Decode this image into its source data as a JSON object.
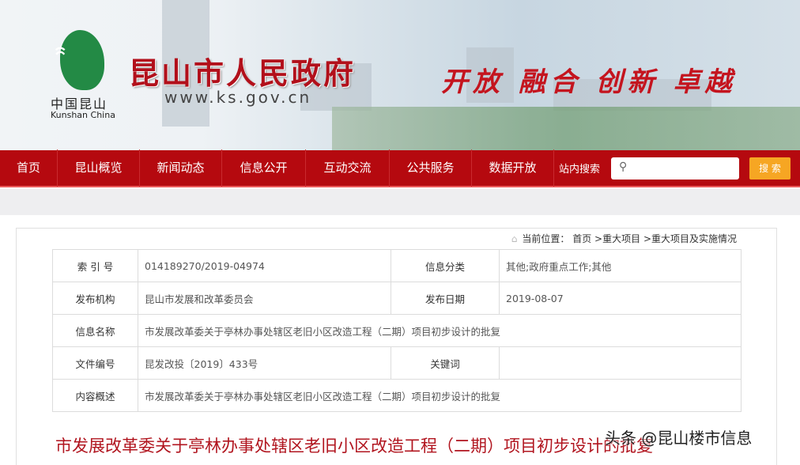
{
  "header": {
    "logo_cn": "中国昆山",
    "logo_en": "Kunshan China",
    "title": "昆山市人民政府",
    "url": "www.ks.gov.cn",
    "slogan": "开放 融合 创新 卓越"
  },
  "nav": {
    "items": [
      "首页",
      "昆山概览",
      "新闻动态",
      "信息公开",
      "互动交流",
      "公共服务",
      "数据开放"
    ],
    "search_label": "站内搜索",
    "search_placeholder": "",
    "search_button": "搜 索"
  },
  "breadcrumb": {
    "prefix": "当前位置：",
    "items": [
      "首页",
      ">重大项目",
      ">重大项目及实施情况"
    ]
  },
  "info": {
    "index_label": "索 引 号",
    "index_value": "014189270/2019-04974",
    "category_label": "信息分类",
    "category_value": "其他;政府重点工作;其他",
    "org_label": "发布机构",
    "org_value": "昆山市发展和改革委员会",
    "date_label": "发布日期",
    "date_value": "2019-08-07",
    "name_label": "信息名称",
    "name_value": "市发展改革委关于亭林办事处辖区老旧小区改造工程（二期）项目初步设计的批复",
    "docno_label": "文件编号",
    "docno_value": "昆发改投〔2019〕433号",
    "keyword_label": "关键词",
    "keyword_value": "",
    "summary_label": "内容概述",
    "summary_value": "市发展改革委关于亭林办事处辖区老旧小区改造工程（二期）项目初步设计的批复"
  },
  "doc_title": "市发展改革委关于亭林办事处辖区老旧小区改造工程（二期）项目初步设计的批复",
  "watermark": "头条 @昆山楼市信息",
  "colors": {
    "nav": "#b5090f",
    "title": "#b1151f",
    "search_button": "#f6a623",
    "logo": "#238a45"
  }
}
